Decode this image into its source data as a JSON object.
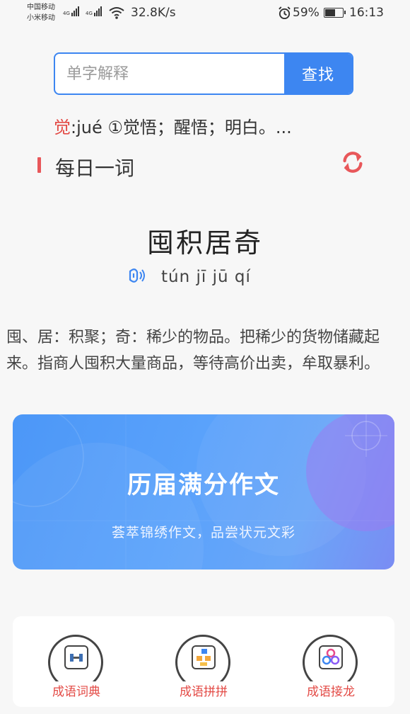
{
  "status_bar": {
    "carrier1": "中国移动",
    "carrier2": "小米移动",
    "sig1": "4G",
    "sig2": "4G",
    "net_speed": "32.8K/s",
    "battery": "59%",
    "battery_level": 0.59,
    "time": "16:13"
  },
  "search": {
    "placeholder": "单字解释",
    "button": "查找"
  },
  "char_def": {
    "char": "觉",
    "text": ":jué ①觉悟；醒悟；明白。..."
  },
  "daily": {
    "section_title": "每日一词",
    "idiom": "囤积居奇",
    "pinyin": "tún jī jū qí",
    "explanation": "囤、居：积聚；奇：稀少的物品。把稀少的货物储藏起来。指商人囤积大量商品，等待高价出卖，牟取暴利。"
  },
  "banner": {
    "title": "历届满分作文",
    "subtitle": "荟萃锦绣作文，品尝状元文彩"
  },
  "tools": [
    {
      "label": "成语词典",
      "icon": "dictionary-icon"
    },
    {
      "label": "成语拼拼",
      "icon": "puzzle-icon"
    },
    {
      "label": "成语接龙",
      "icon": "chain-icon"
    }
  ],
  "colors": {
    "accent_blue": "#3d86f1",
    "accent_red": "#e34a45"
  }
}
